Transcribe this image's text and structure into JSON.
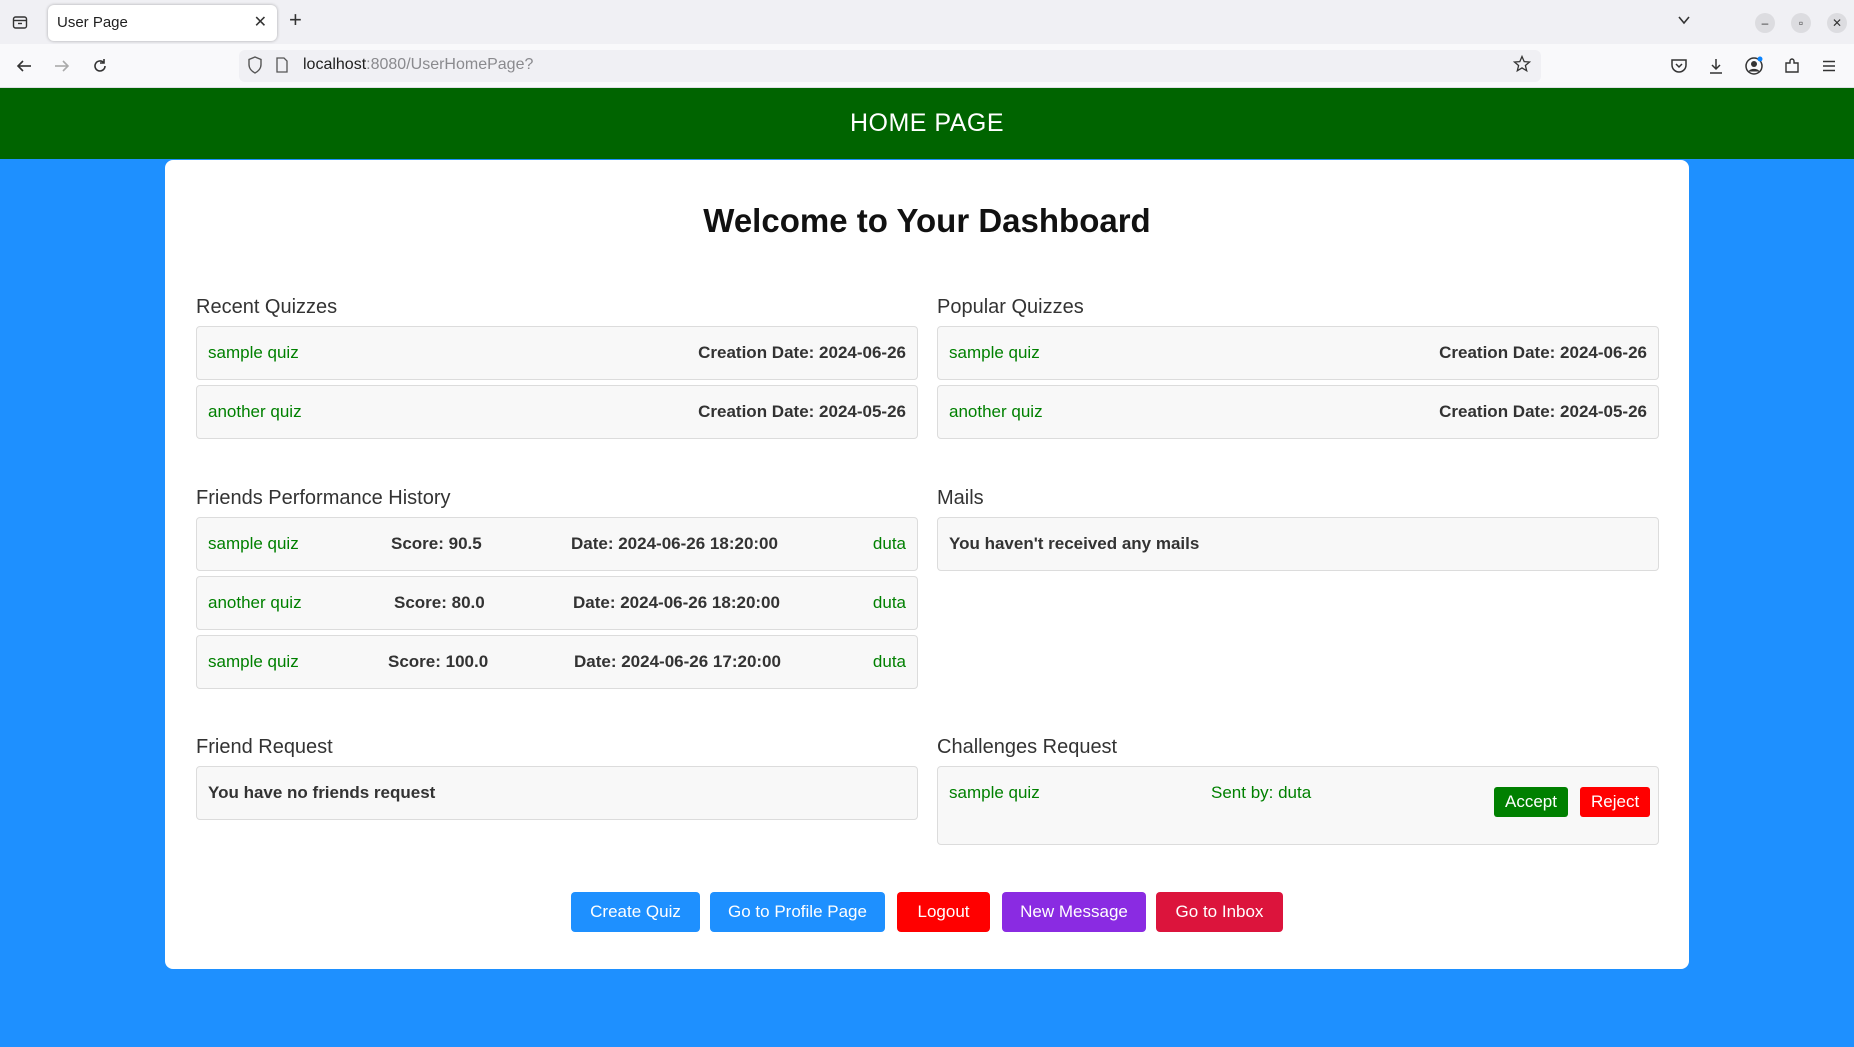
{
  "browser": {
    "tab_title": "User Page",
    "tab_close": "✕",
    "new_tab": "+",
    "url_host": "localhost",
    "url_rest": ":8080/UserHomePage?"
  },
  "header": {
    "title": "HOME PAGE"
  },
  "dashboard": {
    "title": "Welcome to Your Dashboard"
  },
  "recent_quizzes": {
    "title": "Recent Quizzes",
    "items": [
      {
        "name": "sample quiz",
        "date": "Creation Date: 2024-06-26"
      },
      {
        "name": "another quiz",
        "date": "Creation Date: 2024-05-26"
      }
    ]
  },
  "popular_quizzes": {
    "title": "Popular Quizzes",
    "items": [
      {
        "name": "sample quiz",
        "date": "Creation Date: 2024-06-26"
      },
      {
        "name": "another quiz",
        "date": "Creation Date: 2024-05-26"
      }
    ]
  },
  "friends_performance": {
    "title": "Friends Performance History",
    "items": [
      {
        "quiz": "sample quiz",
        "score": "Score: 90.5",
        "date": "Date: 2024-06-26 18:20:00",
        "user": "duta"
      },
      {
        "quiz": "another quiz",
        "score": "Score: 80.0",
        "date": "Date: 2024-06-26 18:20:00",
        "user": "duta"
      },
      {
        "quiz": "sample quiz",
        "score": "Score: 100.0",
        "date": "Date: 2024-06-26 17:20:00",
        "user": "duta"
      }
    ]
  },
  "mails": {
    "title": "Mails",
    "empty": "You haven't received any mails"
  },
  "friend_request": {
    "title": "Friend Request",
    "empty": "You have no friends request"
  },
  "challenges": {
    "title": "Challenges Request",
    "items": [
      {
        "quiz": "sample quiz",
        "sent_by": "Sent by: duta",
        "accept": "Accept",
        "reject": "Reject"
      }
    ]
  },
  "actions": {
    "create_quiz": "Create Quiz",
    "profile": "Go to Profile Page",
    "logout": "Logout",
    "new_message": "New Message",
    "inbox": "Go to Inbox"
  },
  "colors": {
    "header": "#006400",
    "background": "#1e90ff",
    "link": "#008000",
    "blue_button": "#1e90ff",
    "red_button": "#ff0000",
    "purple_button": "#8a2be2",
    "crimson_button": "#dc143c",
    "accept_button": "#008000"
  }
}
